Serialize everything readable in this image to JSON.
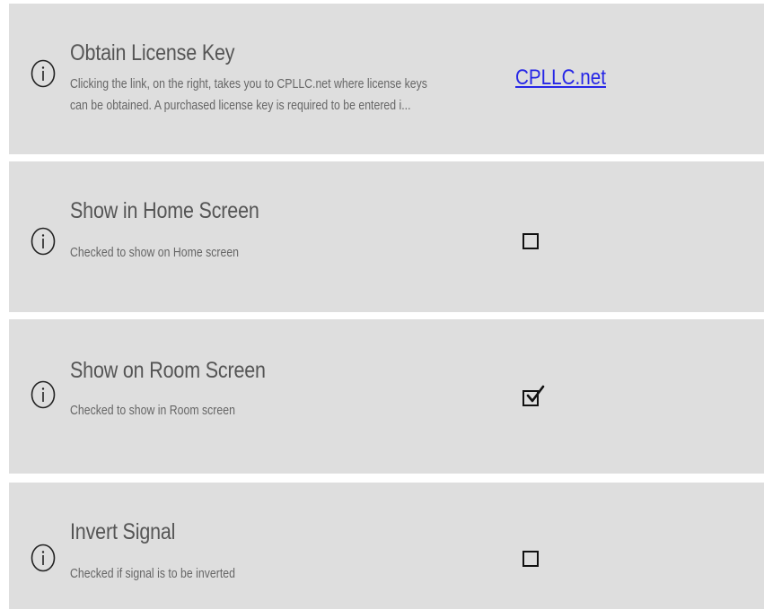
{
  "settings": [
    {
      "title": "Obtain License Key",
      "description_line1": "Clicking the link, on the right, takes you to CPLLC.net where license keys",
      "description_line2": "can be obtained.  A purchased license key is required to be entered i...",
      "control": "link",
      "link_text": "CPLLC.net",
      "icon": "info-circle-icon"
    },
    {
      "title": "Show in Home Screen",
      "description": "Checked to show on Home screen",
      "control": "checkbox",
      "checked": false,
      "icon": "info-circle-icon"
    },
    {
      "title": "Show on Room Screen",
      "description": "Checked to show in Room screen",
      "control": "checkbox",
      "checked": true,
      "icon": "info-circle-icon"
    },
    {
      "title": "Invert Signal",
      "description": "Checked if signal is to be inverted",
      "control": "checkbox",
      "checked": false,
      "icon": "info-circle-icon"
    }
  ],
  "colors": {
    "row_background": "#dedede",
    "title_text": "#555555",
    "description_text": "#666666",
    "link": "#2626e6",
    "checkbox_border": "#111111"
  }
}
